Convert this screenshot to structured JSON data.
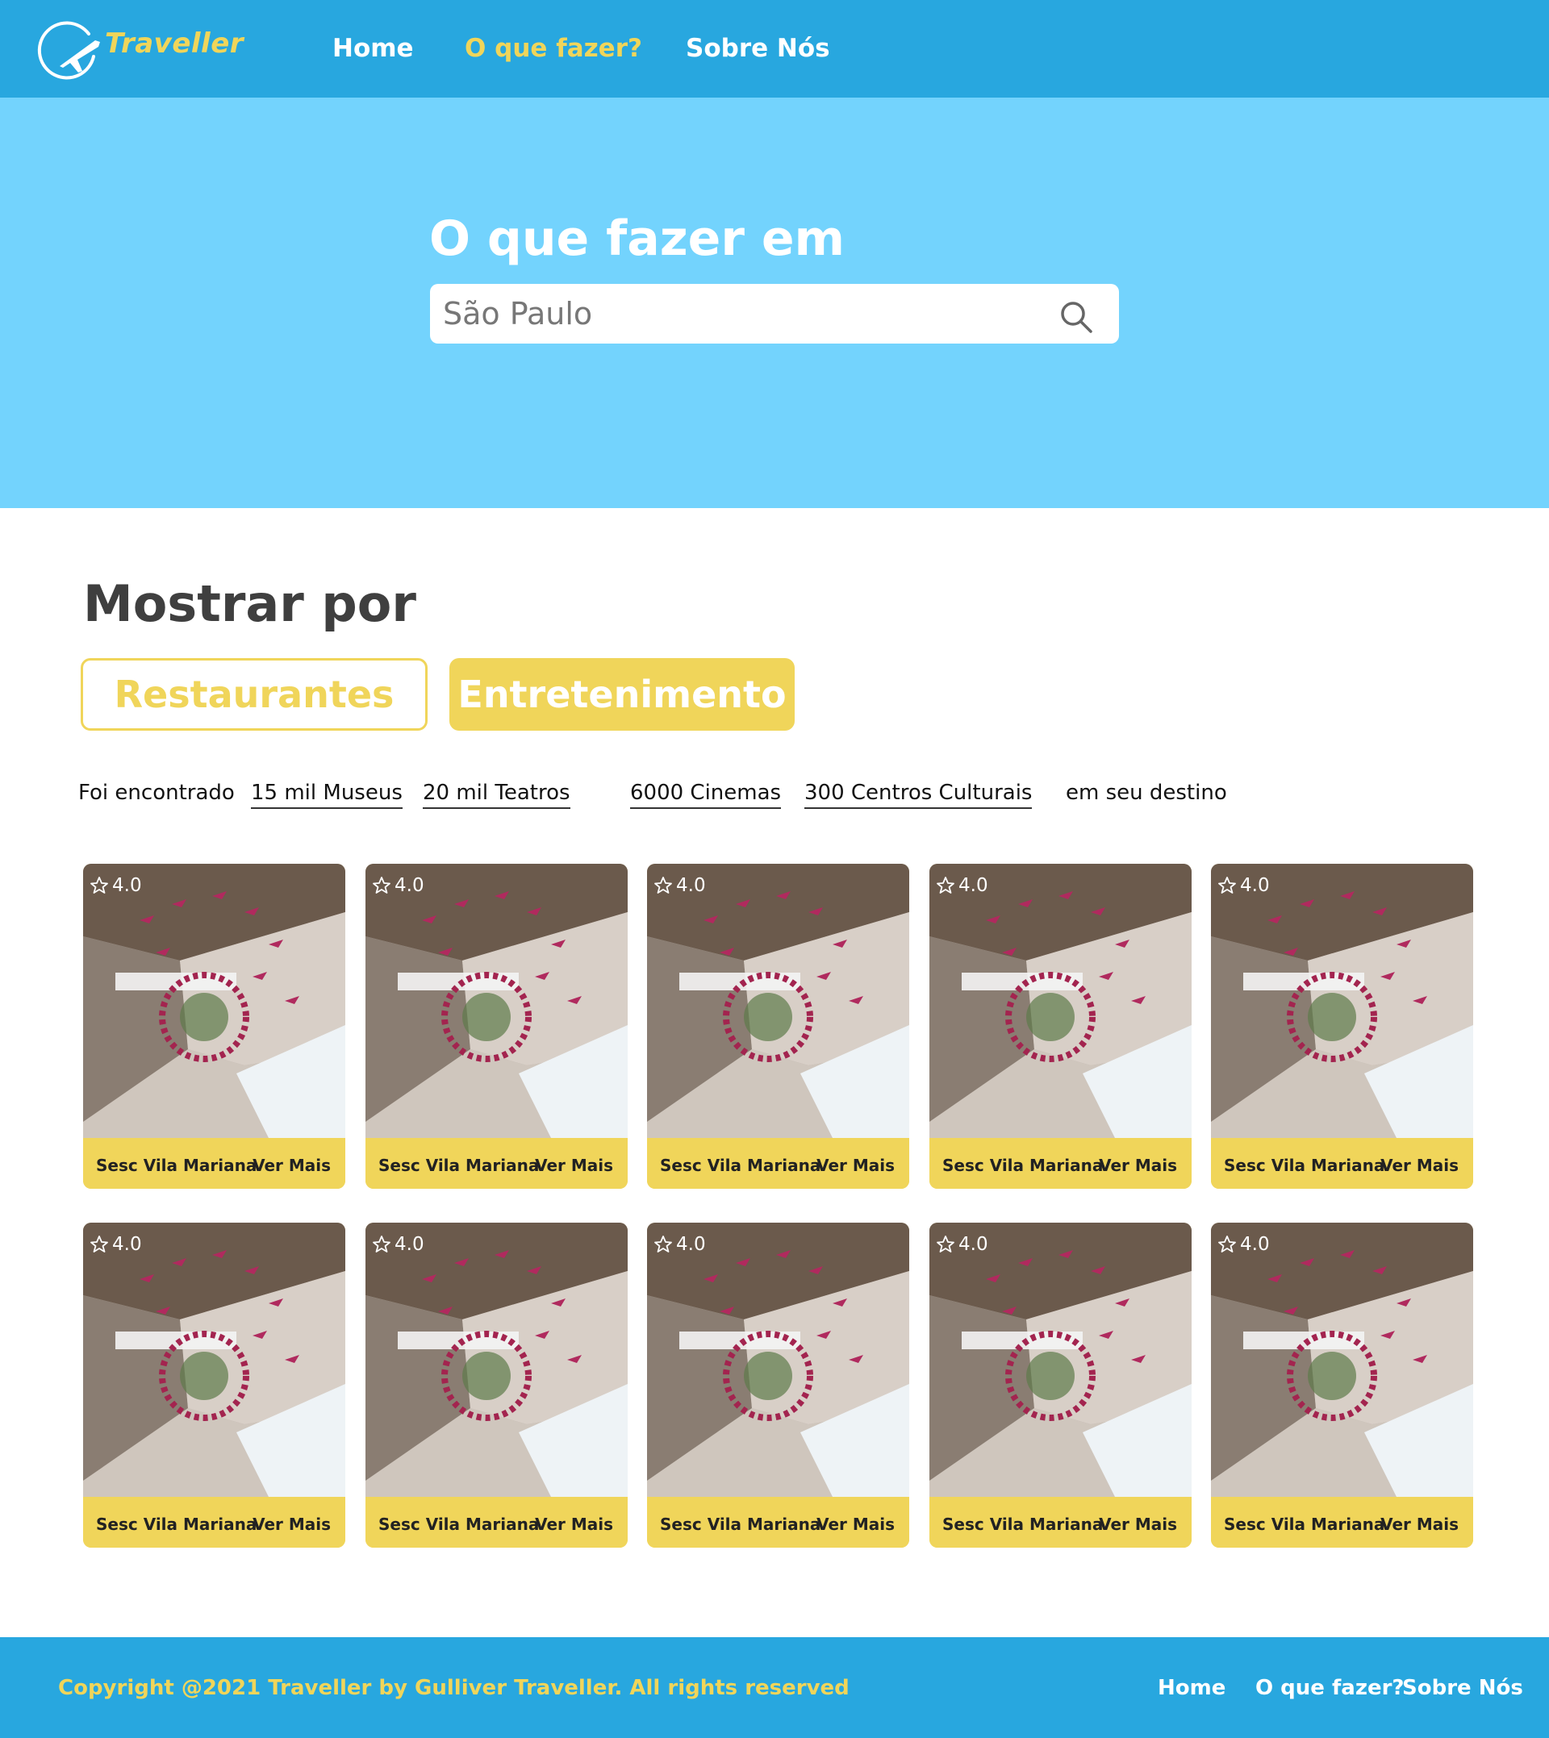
{
  "brand": {
    "name": "Traveller"
  },
  "nav": {
    "home": "Home",
    "what_to_do": "O que fazer?",
    "about": "Sobre Nós"
  },
  "hero": {
    "title": "O que fazer em",
    "search_value": "São Paulo",
    "search_placeholder": "São Paulo"
  },
  "filter": {
    "title": "Mostrar por",
    "options": [
      "Restaurantes",
      "Entretenimento"
    ],
    "selected": "Entretenimento"
  },
  "found": {
    "prefix": "Foi encontrado",
    "links": [
      "15 mil Museus",
      "20 mil Teatros",
      "6000 Cinemas",
      "300 Centros Culturais"
    ],
    "suffix": "em seu destino"
  },
  "cards": [
    {
      "rating": "4.0",
      "name": "Sesc Vila Mariana",
      "action": "Ver Mais"
    },
    {
      "rating": "4.0",
      "name": "Sesc Vila Mariana",
      "action": "Ver Mais"
    },
    {
      "rating": "4.0",
      "name": "Sesc Vila Mariana",
      "action": "Ver Mais"
    },
    {
      "rating": "4.0",
      "name": "Sesc Vila Mariana",
      "action": "Ver Mais"
    },
    {
      "rating": "4.0",
      "name": "Sesc Vila Mariana",
      "action": "Ver Mais"
    },
    {
      "rating": "4.0",
      "name": "Sesc Vila Mariana",
      "action": "Ver Mais"
    },
    {
      "rating": "4.0",
      "name": "Sesc Vila Mariana",
      "action": "Ver Mais"
    },
    {
      "rating": "4.0",
      "name": "Sesc Vila Mariana",
      "action": "Ver Mais"
    },
    {
      "rating": "4.0",
      "name": "Sesc Vila Mariana",
      "action": "Ver Mais"
    },
    {
      "rating": "4.0",
      "name": "Sesc Vila Mariana",
      "action": "Ver Mais"
    }
  ],
  "footer": {
    "copyright": "Copyright @2021 Traveller by Gulliver Traveller. All rights reserved",
    "links": [
      "Home",
      "O que fazer?",
      "Sobre Nós"
    ]
  },
  "colors": {
    "header_blue": "#28a7df",
    "hero_blue": "#73d3fd",
    "accent_yellow": "#f0d55a",
    "heading_gray": "#3f3f3f"
  },
  "icons": {
    "logo": "plane-globe-icon",
    "search": "search-icon",
    "rating": "star-icon"
  }
}
